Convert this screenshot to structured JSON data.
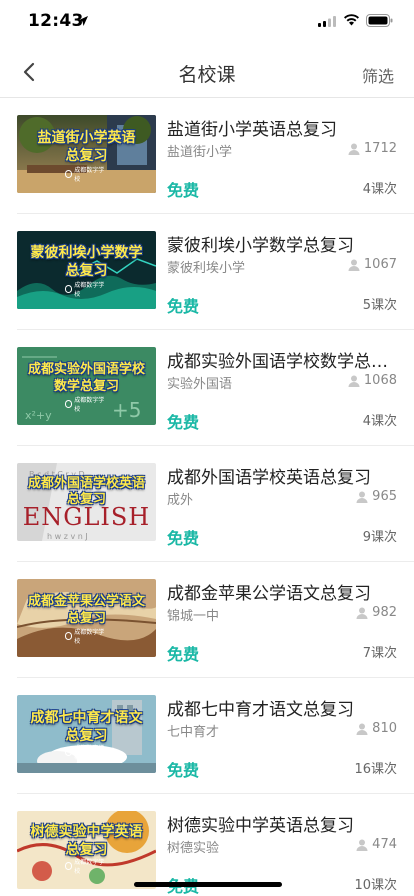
{
  "status": {
    "time": "12:43"
  },
  "nav": {
    "title": "名校课",
    "filter_label": "筛选"
  },
  "courses": [
    {
      "name": "盐道街小学英语总复习",
      "school": "盐道街小学",
      "views": "1712",
      "price": "免费",
      "lessons": "4课次",
      "thumb_lines": [
        "盐道街小学英语",
        "总复习"
      ],
      "thumb_logo": "成都数字学校"
    },
    {
      "name": "蒙彼利埃小学数学总复习",
      "school": "蒙彼利埃小学",
      "views": "1067",
      "price": "免费",
      "lessons": "5课次",
      "thumb_lines": [
        "蒙彼利埃小学数学",
        "总复习"
      ],
      "thumb_logo": "成都数字学校"
    },
    {
      "name": "成都实验外国语学校数学总复习",
      "school": "实验外国语",
      "views": "1068",
      "price": "免费",
      "lessons": "4课次",
      "thumb_lines": [
        "成都实验外国语学校",
        "数学总复习"
      ],
      "thumb_logo": "成都数字学校"
    },
    {
      "name": "成都外国语学校英语总复习",
      "school": "成外",
      "views": "965",
      "price": "免费",
      "lessons": "9课次",
      "thumb_lines": [
        "成都外国语学校英语",
        "总复习"
      ],
      "thumb_logo": "成都数字学校",
      "thumb_extra": "ENGLISH"
    },
    {
      "name": "成都金苹果公学语文总复习",
      "school": "锦城一中",
      "views": "982",
      "price": "免费",
      "lessons": "7课次",
      "thumb_lines": [
        "成都金苹果公学语文",
        "总复习"
      ],
      "thumb_logo": "成都数字学校"
    },
    {
      "name": "成都七中育才语文总复习",
      "school": "七中育才",
      "views": "810",
      "price": "免费",
      "lessons": "16课次",
      "thumb_lines": [
        "成都七中育才语文",
        "总复习"
      ],
      "thumb_logo": "成都数字学校"
    },
    {
      "name": "树德实验中学英语总复习",
      "school": "树德实验",
      "views": "474",
      "price": "免费",
      "lessons": "10课次",
      "thumb_lines": [
        "树德实验中学英语",
        "总复习"
      ],
      "thumb_logo": "成都数字学校"
    }
  ],
  "colors": {
    "accent": "#1bb8a6",
    "thumb_text": "#ffe94a",
    "thumb_outline": "#173a8a"
  },
  "icons": {
    "back": "chevron-left-icon",
    "views": "user-icon",
    "location": "location-arrow-icon",
    "signal": "signal-icon",
    "wifi": "wifi-icon",
    "battery": "battery-icon"
  }
}
